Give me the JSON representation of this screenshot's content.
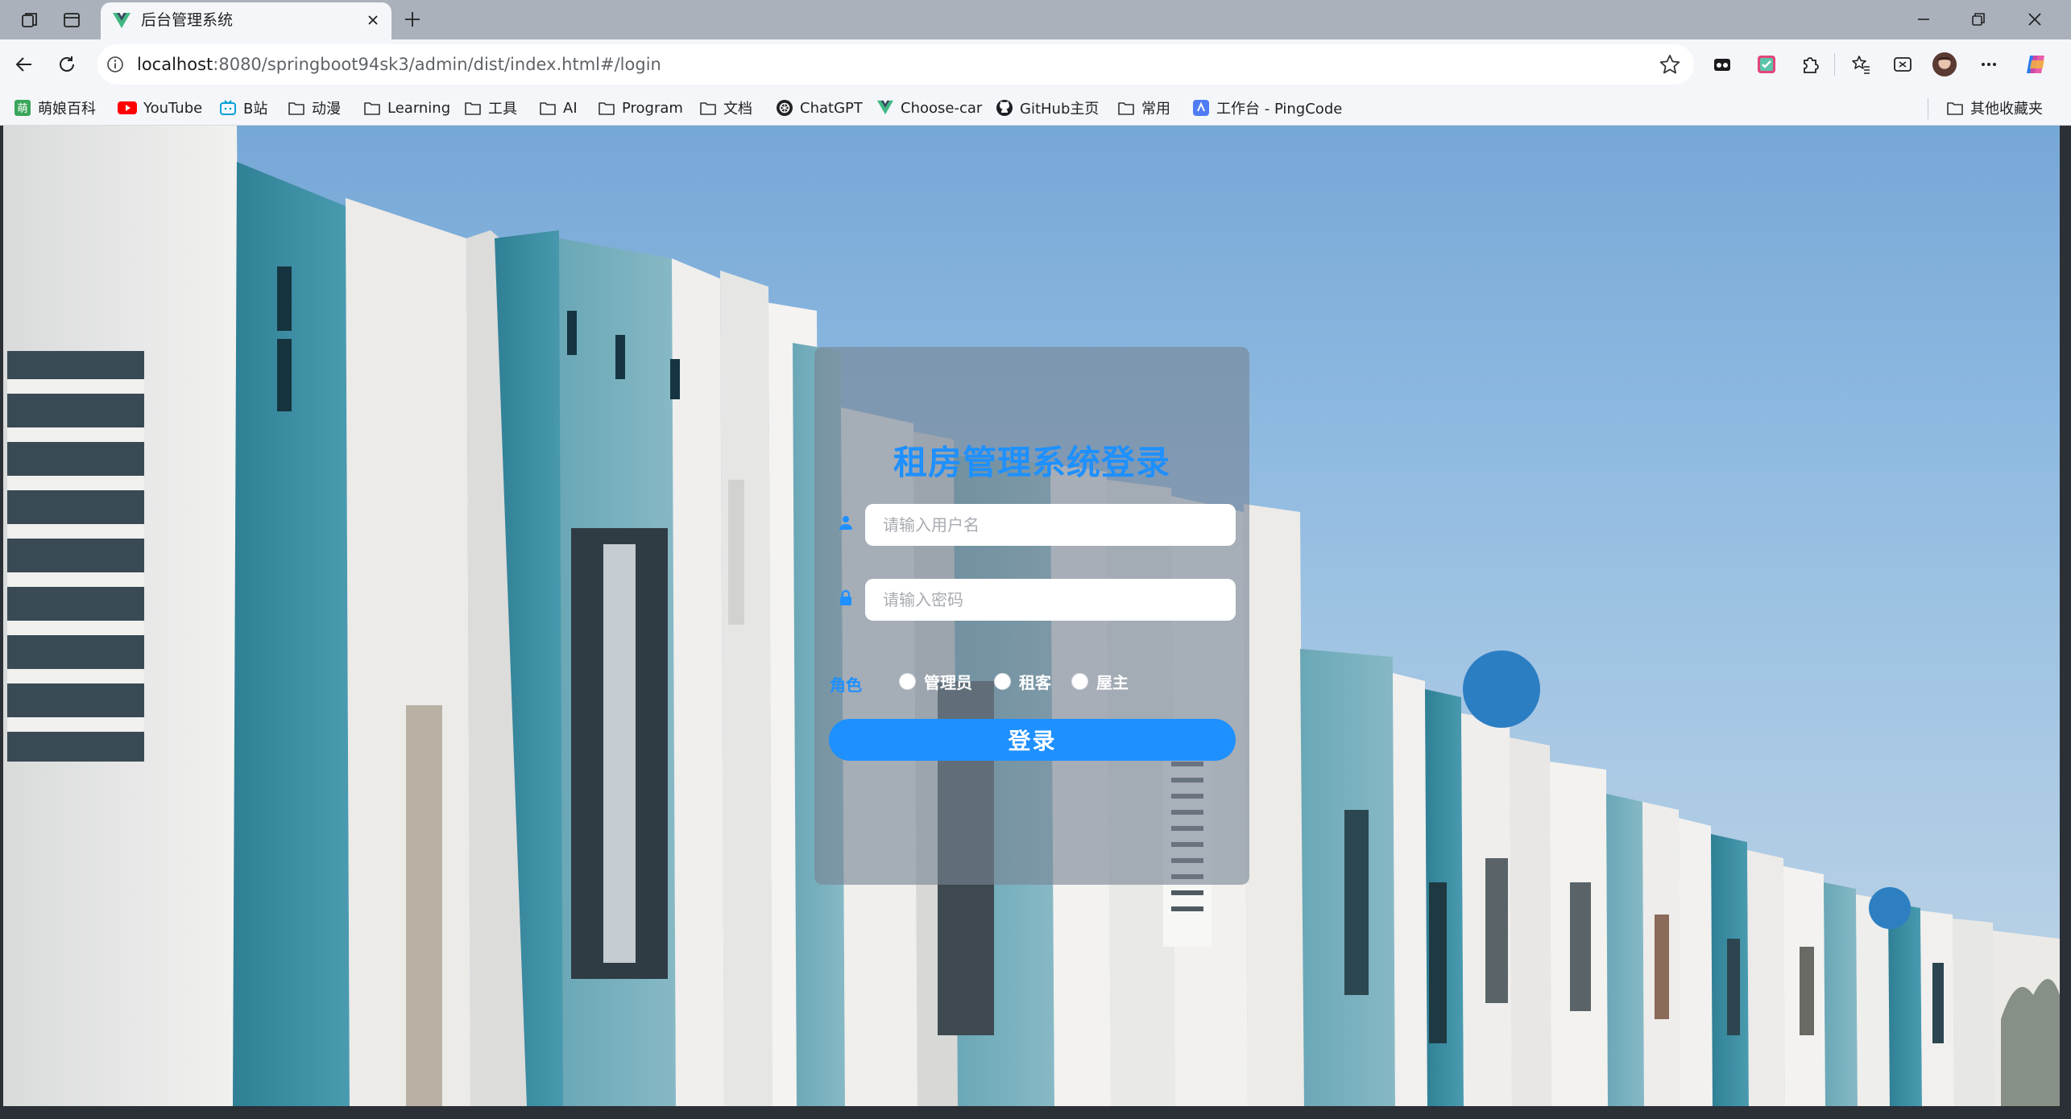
{
  "browser": {
    "tab": {
      "title": "后台管理系统"
    },
    "url": {
      "host": "localhost",
      "rest": ":8080/springboot94sk3/admin/dist/index.html#/login"
    },
    "bookmarks": [
      {
        "label": "萌娘百科",
        "icon": "moegirl-icon"
      },
      {
        "label": "YouTube",
        "icon": "youtube-icon"
      },
      {
        "label": "B站",
        "icon": "bilibili-icon"
      },
      {
        "label": "动漫",
        "icon": "folder-icon"
      },
      {
        "label": "Learning",
        "icon": "folder-icon"
      },
      {
        "label": "工具",
        "icon": "folder-icon"
      },
      {
        "label": "AI",
        "icon": "folder-icon"
      },
      {
        "label": "Program",
        "icon": "folder-icon"
      },
      {
        "label": "文档",
        "icon": "folder-icon"
      },
      {
        "label": "ChatGPT",
        "icon": "chatgpt-icon"
      },
      {
        "label": "Choose-car",
        "icon": "vue-icon"
      },
      {
        "label": "GitHub主页",
        "icon": "github-icon"
      },
      {
        "label": "常用",
        "icon": "folder-icon"
      },
      {
        "label": "工作台 - PingCode",
        "icon": "pingcode-icon"
      }
    ],
    "other_bookmarks": "其他收藏夹"
  },
  "login": {
    "title": "租房管理系统登录",
    "username_placeholder": "请输入用户名",
    "password_placeholder": "请输入密码",
    "role_label": "角色",
    "roles": [
      "管理员",
      "租客",
      "屋主"
    ],
    "submit": "登录"
  },
  "colors": {
    "accent": "#1e90ff",
    "card": "rgba(120,132,148,0.62)"
  }
}
